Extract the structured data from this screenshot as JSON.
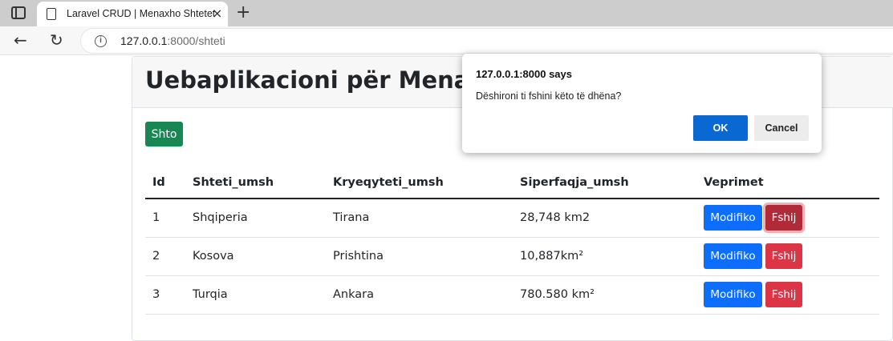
{
  "browser": {
    "tab_title": "Laravel CRUD | Menaxho Shtetet",
    "tab_close": "×",
    "new_tab": "+",
    "back": "←",
    "reload": "↻",
    "info": "i",
    "url_host": "127.0.0.1",
    "url_rest": ":8000/shteti"
  },
  "page": {
    "title": "Uebaplikacioni për Menaxh",
    "add_label": "Shto"
  },
  "table": {
    "headers": [
      "Id",
      "Shteti_umsh",
      "Kryeqyteti_umsh",
      "Siperfaqja_umsh",
      "Veprimet"
    ],
    "rows": [
      {
        "id": "1",
        "shteti": "Shqiperia",
        "kryeqyteti": "Tirana",
        "siperfaqja": "28,748 km2",
        "edit": "Modifiko",
        "delete": "Fshij"
      },
      {
        "id": "2",
        "shteti": "Kosova",
        "kryeqyteti": "Prishtina",
        "siperfaqja": "10,887km²",
        "edit": "Modifiko",
        "delete": "Fshij"
      },
      {
        "id": "3",
        "shteti": "Turqia",
        "kryeqyteti": "Ankara",
        "siperfaqja": "780.580 km²",
        "edit": "Modifiko",
        "delete": "Fshij"
      }
    ]
  },
  "dialog": {
    "title": "127.0.0.1:8000 says",
    "message": "Dëshironi ti fshini këto të dhëna?",
    "ok_label": "OK",
    "cancel_label": "Cancel"
  },
  "colors": {
    "add_button": "#198754",
    "edit_button": "#0d6efd",
    "delete_button": "#dc3545",
    "dialog_ok": "#0a68d3"
  }
}
